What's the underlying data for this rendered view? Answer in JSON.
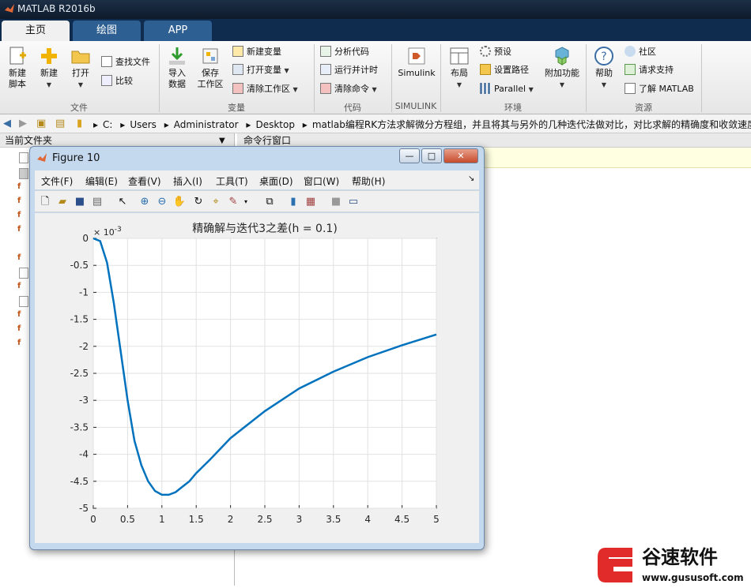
{
  "app": {
    "title": "MATLAB R2016b"
  },
  "tabs": [
    {
      "label": "主页"
    },
    {
      "label": "绘图"
    },
    {
      "label": "APP"
    }
  ],
  "ribbon": {
    "file": {
      "new_script": "新建\n脚本",
      "new": "新建",
      "open": "打开",
      "find_files": "查找文件",
      "compare": "比较",
      "group": "文件"
    },
    "variable": {
      "import": "导入\n数据",
      "save_ws": "保存\n工作区",
      "new_var": "新建变量",
      "open_var": "打开变量",
      "clear_ws": "清除工作区",
      "group": "变量"
    },
    "code": {
      "analyze": "分析代码",
      "run_time": "运行并计时",
      "clear_cmd": "清除命令",
      "group": "代码"
    },
    "simulink": {
      "label": "Simulink",
      "group": "SIMULINK"
    },
    "env": {
      "layout": "布局",
      "prefs": "预设",
      "set_path": "设置路径",
      "parallel": "Parallel",
      "addons": "附加功能",
      "group": "环境"
    },
    "resources": {
      "help": "帮助",
      "community": "社区",
      "support": "请求支持",
      "learn": "了解 MATLAB",
      "group": "资源"
    }
  },
  "address": {
    "crumbs": [
      "C:",
      "Users",
      "Administrator",
      "Desktop",
      "matlab编程RK方法求解微分方程组，并且将其与另外的几种迭代法做对比，对比求解的精确度和收敛速度"
    ]
  },
  "panels": {
    "current_folder": "当前文件夹",
    "command_window": "命令行窗口"
  },
  "figure": {
    "title": "Figure 10",
    "menu": [
      "文件(F)",
      "编辑(E)",
      "查看(V)",
      "插入(I)",
      "工具(T)",
      "桌面(D)",
      "窗口(W)",
      "帮助(H)"
    ],
    "window_buttons": [
      "minimize",
      "maximize",
      "close"
    ]
  },
  "chart_data": {
    "type": "line",
    "title": "精确解与迭代3之差(h = 0.1)",
    "exponent_label": "× 10^-3",
    "xlabel": "",
    "ylabel": "",
    "xlim": [
      0,
      5
    ],
    "ylim": [
      -5,
      0
    ],
    "xticks": [
      "0",
      "0.5",
      "1",
      "1.5",
      "2",
      "2.5",
      "3",
      "3.5",
      "4",
      "4.5",
      "5"
    ],
    "yticks": [
      "0",
      "-0.5",
      "-1",
      "-1.5",
      "-2",
      "-2.5",
      "-3",
      "-3.5",
      "-4",
      "-4.5",
      "-5"
    ],
    "grid": true,
    "color": "#0072bd",
    "series": [
      {
        "x": [
          0,
          0.1,
          0.2,
          0.3,
          0.4,
          0.5,
          0.6,
          0.7,
          0.8,
          0.9,
          1.0,
          1.1,
          1.2,
          1.3,
          1.4,
          1.5,
          1.7,
          2.0,
          2.5,
          3.0,
          3.5,
          4.0,
          4.5,
          5.0
        ],
        "y": [
          0,
          -0.05,
          -0.45,
          -1.2,
          -2.1,
          -3.0,
          -3.75,
          -4.2,
          -4.5,
          -4.68,
          -4.75,
          -4.75,
          -4.7,
          -4.6,
          -4.5,
          -4.35,
          -4.1,
          -3.7,
          -3.2,
          -2.78,
          -2.47,
          -2.2,
          -1.98,
          -1.78
        ]
      }
    ]
  },
  "watermark": {
    "name": "谷速软件",
    "url": "www.gususoft.com"
  }
}
